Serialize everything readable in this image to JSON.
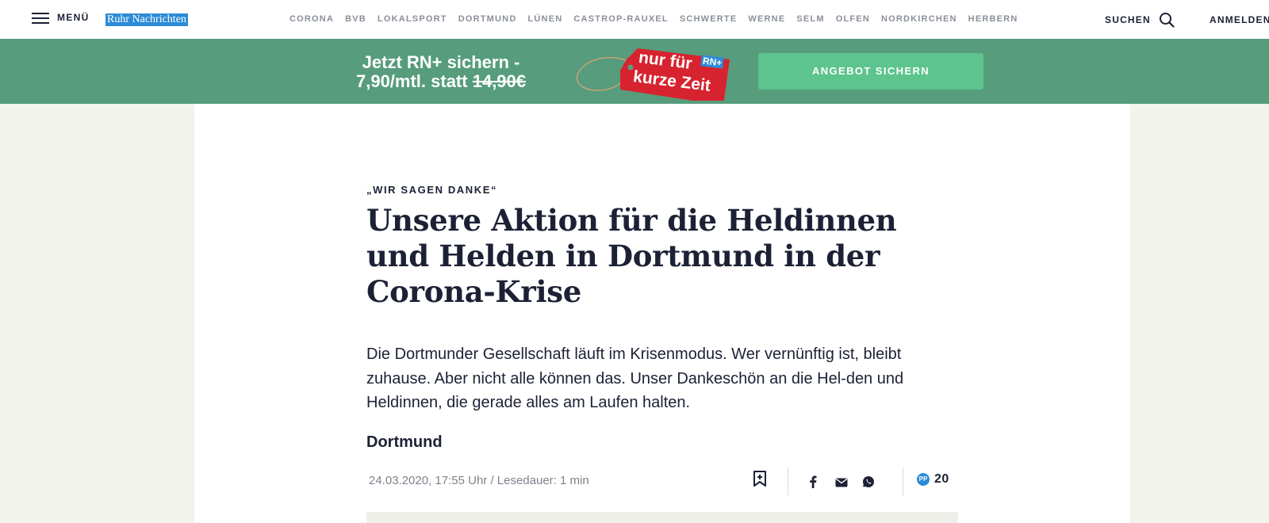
{
  "header": {
    "menu_label": "MENÜ",
    "logo_text": "Ruhr Nachrichten",
    "nav_items": [
      "CORONA",
      "BVB",
      "LOKALSPORT",
      "DORTMUND",
      "LÜNEN",
      "CASTROP-RAUXEL",
      "SCHWERTE",
      "WERNE",
      "SELM",
      "OLFEN",
      "NORDKIRCHEN",
      "HERBERN"
    ],
    "search_label": "SUCHEN",
    "login_label": "ANMELDEN"
  },
  "promo": {
    "line1": "Jetzt RN+ sichern -",
    "line2_prefix": "7,90/mtl. statt",
    "old_price": "14,90€",
    "tag_line1": "nur für",
    "tag_line2": "kurze Zeit",
    "tag_badge": "RN+",
    "cta_label": "ANGEBOT SICHERN"
  },
  "article": {
    "kicker": "„WIR SAGEN DANKE“",
    "headline": "Unsere Aktion für die Heldinnen und Helden in Dortmund in der Corona-Krise",
    "lead": "Die Dortmunder Gesellschaft läuft im Krisenmodus. Wer vernünftig ist, bleibt zuhause. Aber nicht alle können das. Unser Dankeschön an die Hel-den und Heldinnen, die gerade alles am Laufen halten.",
    "location": "Dortmund",
    "meta": "24.03.2020, 17:55 Uhr / Lesedauer: 1 min",
    "pp_icon": "PP",
    "pp_count": "20"
  },
  "colors": {
    "promo_bg": "#569c7d",
    "cta_bg": "#5cc48c",
    "logo_bg": "#2d8bd6",
    "tag_red": "#d7232f",
    "text_dark": "#1c2135"
  },
  "icons": [
    "hamburger-icon",
    "search-icon",
    "bookmark-add-icon",
    "facebook-icon",
    "email-icon",
    "whatsapp-icon",
    "pp-icon"
  ]
}
